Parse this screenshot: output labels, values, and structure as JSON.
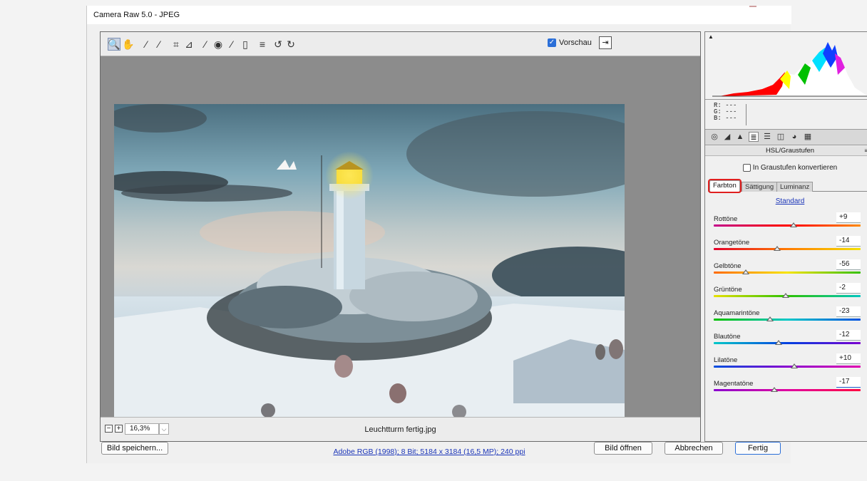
{
  "window": {
    "title": "Camera Raw 5.0 - JPEG"
  },
  "toolbar": {
    "tools": [
      {
        "name": "zoom-tool-icon",
        "glyph": "🔍"
      },
      {
        "name": "hand-tool-icon",
        "glyph": "✋"
      },
      {
        "name": "white-balance-tool-icon",
        "glyph": "⁄"
      },
      {
        "name": "color-sampler-tool-icon",
        "glyph": "⁄"
      },
      {
        "name": "crop-tool-icon",
        "glyph": "⌗"
      },
      {
        "name": "straighten-tool-icon",
        "glyph": "⊿"
      },
      {
        "name": "spot-removal-tool-icon",
        "glyph": "⁄"
      },
      {
        "name": "red-eye-tool-icon",
        "glyph": "◉"
      },
      {
        "name": "adjustment-brush-icon",
        "glyph": "⁄"
      },
      {
        "name": "graduated-filter-icon",
        "glyph": "▯"
      },
      {
        "name": "preferences-icon",
        "glyph": "≡"
      },
      {
        "name": "rotate-left-icon",
        "glyph": "↺"
      },
      {
        "name": "rotate-right-icon",
        "glyph": "↻"
      }
    ],
    "preview_label": "Vorschau",
    "preview_checked": true
  },
  "status": {
    "zoom_value": "16,3%",
    "filename": "Leuchtturm fertig.jpg"
  },
  "histogram": {
    "r_label": "R:",
    "g_label": "G:",
    "b_label": "B:",
    "r": "---",
    "g": "---",
    "b": "---"
  },
  "panel": {
    "title": "HSL/Graustufen",
    "grayscale_label": "In Graustufen konvertieren",
    "grayscale_checked": false,
    "subtabs": [
      "Farbton",
      "Sättigung",
      "Luminanz"
    ],
    "active_subtab": "Farbton",
    "standard_link": "Standard",
    "sliders": [
      {
        "label": "Rottöne",
        "value": "+9",
        "num": 9,
        "gradient": "linear-gradient(90deg,#c4008a,#ff0000,#ff8a00)"
      },
      {
        "label": "Orangetöne",
        "value": "-14",
        "num": -14,
        "gradient": "linear-gradient(90deg,#e3002b,#ff7a00,#f5e100)"
      },
      {
        "label": "Gelbtöne",
        "value": "-56",
        "num": -56,
        "gradient": "linear-gradient(90deg,#ff6a00,#f7e400,#34c000)"
      },
      {
        "label": "Grüntöne",
        "value": "-2",
        "num": -2,
        "gradient": "linear-gradient(90deg,#e7e000,#2dc100,#00c6c0)"
      },
      {
        "label": "Aquamarintöne",
        "value": "-23",
        "num": -23,
        "gradient": "linear-gradient(90deg,#00c000,#00c8c8,#0050e0)"
      },
      {
        "label": "Blautöne",
        "value": "-12",
        "num": -12,
        "gradient": "linear-gradient(90deg,#00c8c8,#0040e0,#7a00d0)"
      },
      {
        "label": "Lilatöne",
        "value": "+10",
        "num": 10,
        "gradient": "linear-gradient(90deg,#0050e0,#8a00d0,#e000b0)"
      },
      {
        "label": "Magentatöne",
        "value": "-17",
        "num": -17,
        "gradient": "linear-gradient(90deg,#8a00d0,#e000a0,#ff0040)"
      }
    ]
  },
  "footer": {
    "save_label": "Bild speichern...",
    "file_info": "Adobe RGB (1998); 8 Bit; 5184 x 3184 (16,5 MP); 240 ppi",
    "open_label": "Bild öffnen",
    "cancel_label": "Abbrechen",
    "done_label": "Fertig"
  }
}
